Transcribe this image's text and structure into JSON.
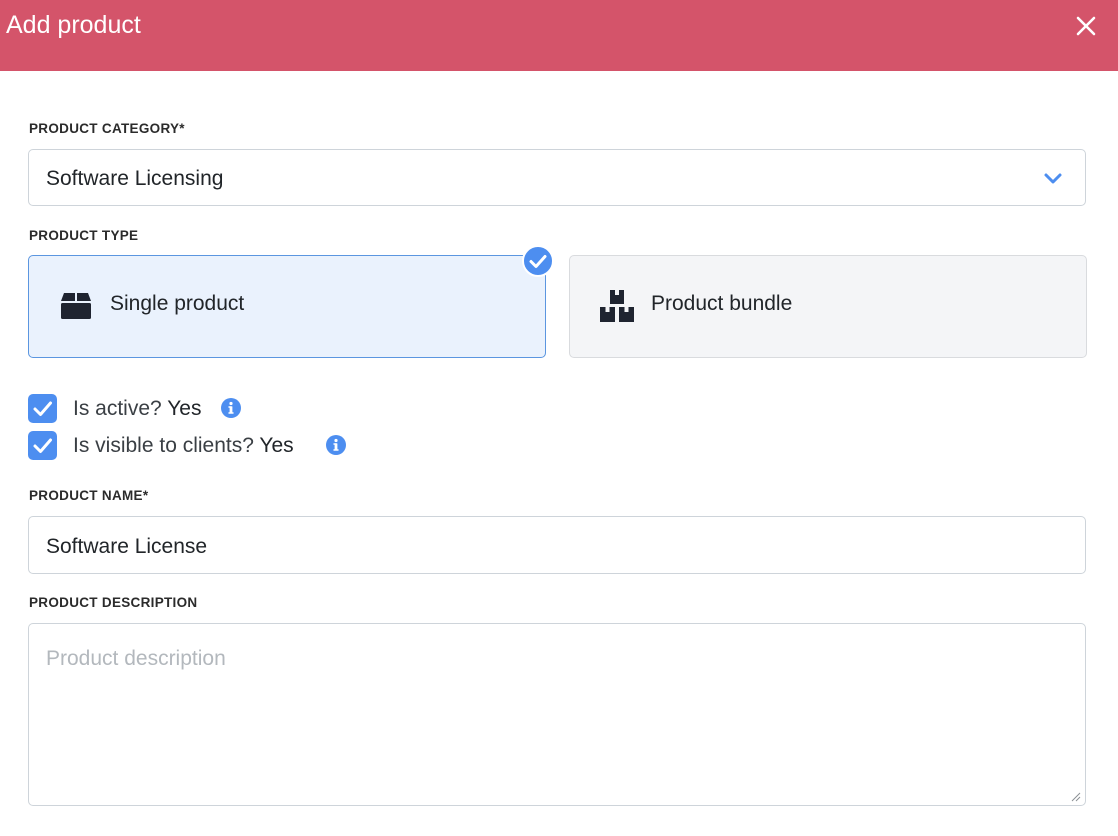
{
  "dialog": {
    "title": "Add product",
    "close_icon": "close-icon"
  },
  "category": {
    "label": "PRODUCT CATEGORY*",
    "selected": "Software Licensing",
    "icon": "chevron-down-icon"
  },
  "product_type": {
    "label": "PRODUCT TYPE",
    "options": [
      {
        "label": "Single product",
        "icon": "box-icon",
        "selected": true
      },
      {
        "label": "Product bundle",
        "icon": "boxes-icon",
        "selected": false
      }
    ]
  },
  "flags": [
    {
      "label": "Is active?",
      "value": "Yes",
      "checked": true,
      "icon": "info-icon"
    },
    {
      "label": "Is visible to clients?",
      "value": "Yes",
      "checked": true,
      "icon": "info-icon"
    }
  ],
  "name": {
    "label": "PRODUCT NAME*",
    "value": "Software License"
  },
  "description": {
    "label": "PRODUCT DESCRIPTION",
    "placeholder": "Product description",
    "value": ""
  },
  "colors": {
    "header": "#d4546a",
    "accent": "#4d8ef0",
    "selected_card_bg": "#eaf2fd"
  }
}
